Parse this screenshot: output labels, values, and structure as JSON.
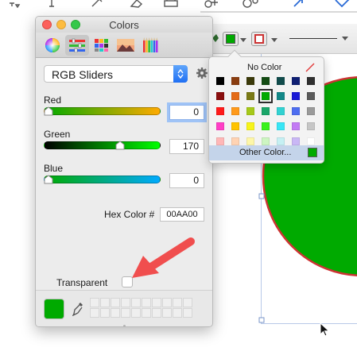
{
  "colors_window": {
    "title": "Colors",
    "modes": [
      "color-wheel",
      "color-sliders",
      "color-palettes",
      "image-palettes",
      "crayons"
    ],
    "selected_mode": "color-sliders",
    "slider_mode_label": "RGB Sliders",
    "sliders": [
      {
        "label": "Red",
        "value": "0",
        "level": 0
      },
      {
        "label": "Green",
        "value": "170",
        "level": 0.667
      },
      {
        "label": "Blue",
        "value": "0",
        "level": 0
      }
    ],
    "hex_label": "Hex Color #",
    "hex_value": "00AA00",
    "transparent_label": "Transparent",
    "current_color": "#00AA00"
  },
  "color_popover": {
    "no_color_label": "No Color",
    "other_color_label": "Other Color...",
    "selected_color": "#00AA00",
    "swatches": [
      "#000000",
      "#8a3d10",
      "#3b3a0a",
      "#144c14",
      "#114c4c",
      "#0f1f73",
      "#2f2f2f",
      "#8a0f0f",
      "#e46a16",
      "#7a7a16",
      "#00AA00",
      "#138888",
      "#1a1ad6",
      "#5a5a5a",
      "#ff1b1b",
      "#ff9a1b",
      "#a6c91a",
      "#1aa66a",
      "#32d2d2",
      "#4e6ef0",
      "#9a9a9a",
      "#ff3fc6",
      "#ffc300",
      "#f7f41a",
      "#39f21b",
      "#38e6f6",
      "#c27af4",
      "#c6c6c6",
      "#ffb7b7",
      "#ffd3b3",
      "#fdf6a8",
      "#cdf5c2",
      "#c6f0f3",
      "#c9b7f5",
      "#ffffff"
    ]
  },
  "shape": {
    "fill": "#00AA00",
    "stroke": "#cc3333"
  },
  "annotation": {
    "arrow_color": "#f04e4e"
  }
}
